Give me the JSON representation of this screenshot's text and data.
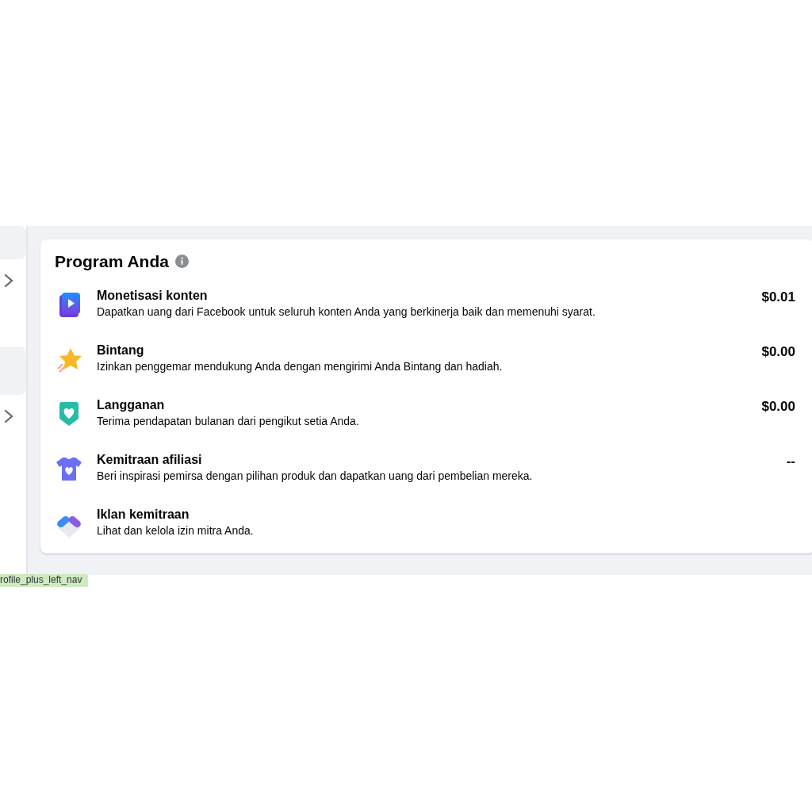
{
  "sidebar": {
    "items": [
      {
        "kind": "card"
      },
      {
        "kind": "chevron"
      },
      {
        "kind": "card"
      },
      {
        "kind": "chevron"
      }
    ]
  },
  "card": {
    "title": "Program Anda",
    "programs": [
      {
        "kind": "video",
        "title": "Monetisasi konten",
        "description": "Dapatkan uang dari Facebook untuk seluruh konten Anda yang berkinerja baik dan memenuhi syarat.",
        "amount": "$0.01"
      },
      {
        "kind": "star",
        "title": "Bintang",
        "description": "Izinkan penggemar mendukung Anda dengan mengirimi Anda Bintang dan hadiah.",
        "amount": "$0.00"
      },
      {
        "kind": "shield",
        "title": "Langganan",
        "description": "Terima pendapatan bulanan dari pengikut setia Anda.",
        "amount": "$0.00"
      },
      {
        "kind": "shirt",
        "title": "Kemitraan afiliasi",
        "description": "Beri inspirasi pemirsa dengan pilihan produk dan dapatkan uang dari pembelian mereka.",
        "amount": "--"
      },
      {
        "kind": "handshake",
        "title": "Iklan kemitraan",
        "description": "Lihat dan kelola izin mitra Anda."
      }
    ]
  },
  "debug_tag": "rofile_plus_left_nav"
}
